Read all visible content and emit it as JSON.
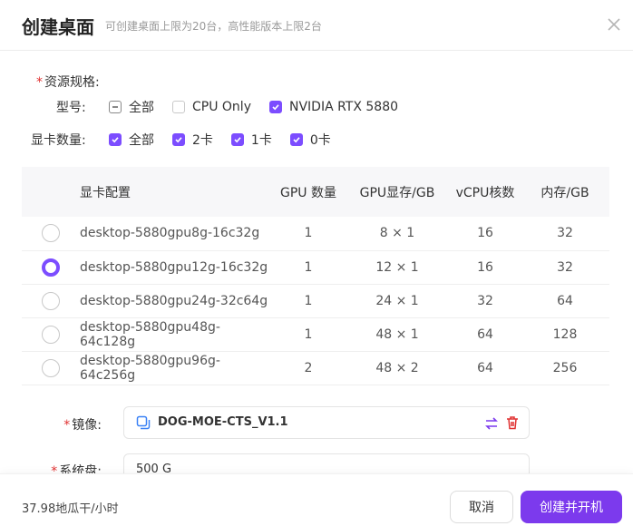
{
  "dialog": {
    "title": "创建桌面",
    "subtitle": "可创建桌面上限为20台，高性能版本上限2台"
  },
  "resource": {
    "label": "资源规格:",
    "model_label": "型号:",
    "model_options": [
      {
        "label": "全部",
        "state": "indeterminate"
      },
      {
        "label": "CPU Only",
        "state": "unchecked"
      },
      {
        "label": "NVIDIA RTX 5880",
        "state": "checked"
      }
    ],
    "gpu_count_label": "显卡数量:",
    "gpu_count_options": [
      {
        "label": "全部",
        "state": "checked"
      },
      {
        "label": "2卡",
        "state": "checked"
      },
      {
        "label": "1卡",
        "state": "checked"
      },
      {
        "label": "0卡",
        "state": "checked"
      }
    ]
  },
  "table": {
    "headers": [
      "显卡配置",
      "GPU 数量",
      "GPU显存/GB",
      "vCPU核数",
      "内存/GB"
    ],
    "rows": [
      {
        "name": "desktop-5880gpu8g-16c32g",
        "gpu": "1",
        "vram": "8 × 1",
        "vcpu": "16",
        "mem": "32",
        "selected": false
      },
      {
        "name": "desktop-5880gpu12g-16c32g",
        "gpu": "1",
        "vram": "12 × 1",
        "vcpu": "16",
        "mem": "32",
        "selected": true
      },
      {
        "name": "desktop-5880gpu24g-32c64g",
        "gpu": "1",
        "vram": "24 × 1",
        "vcpu": "32",
        "mem": "64",
        "selected": false
      },
      {
        "name": "desktop-5880gpu48g-64c128g",
        "gpu": "1",
        "vram": "48 × 1",
        "vcpu": "64",
        "mem": "128",
        "selected": false
      },
      {
        "name": "desktop-5880gpu96g-64c256g",
        "gpu": "2",
        "vram": "48 × 2",
        "vcpu": "64",
        "mem": "256",
        "selected": false
      }
    ]
  },
  "image": {
    "label": "镜像:",
    "value": "DOG-MOE-CTS_V1.1"
  },
  "disk": {
    "label": "系统盘:",
    "value": "500 G"
  },
  "footer": {
    "price": "37.98地瓜干/小时",
    "cancel_label": "取消",
    "create_label": "创建并开机"
  },
  "colors": {
    "accent": "#7c3aed",
    "required": "#e03131",
    "delete": "#e03131"
  }
}
